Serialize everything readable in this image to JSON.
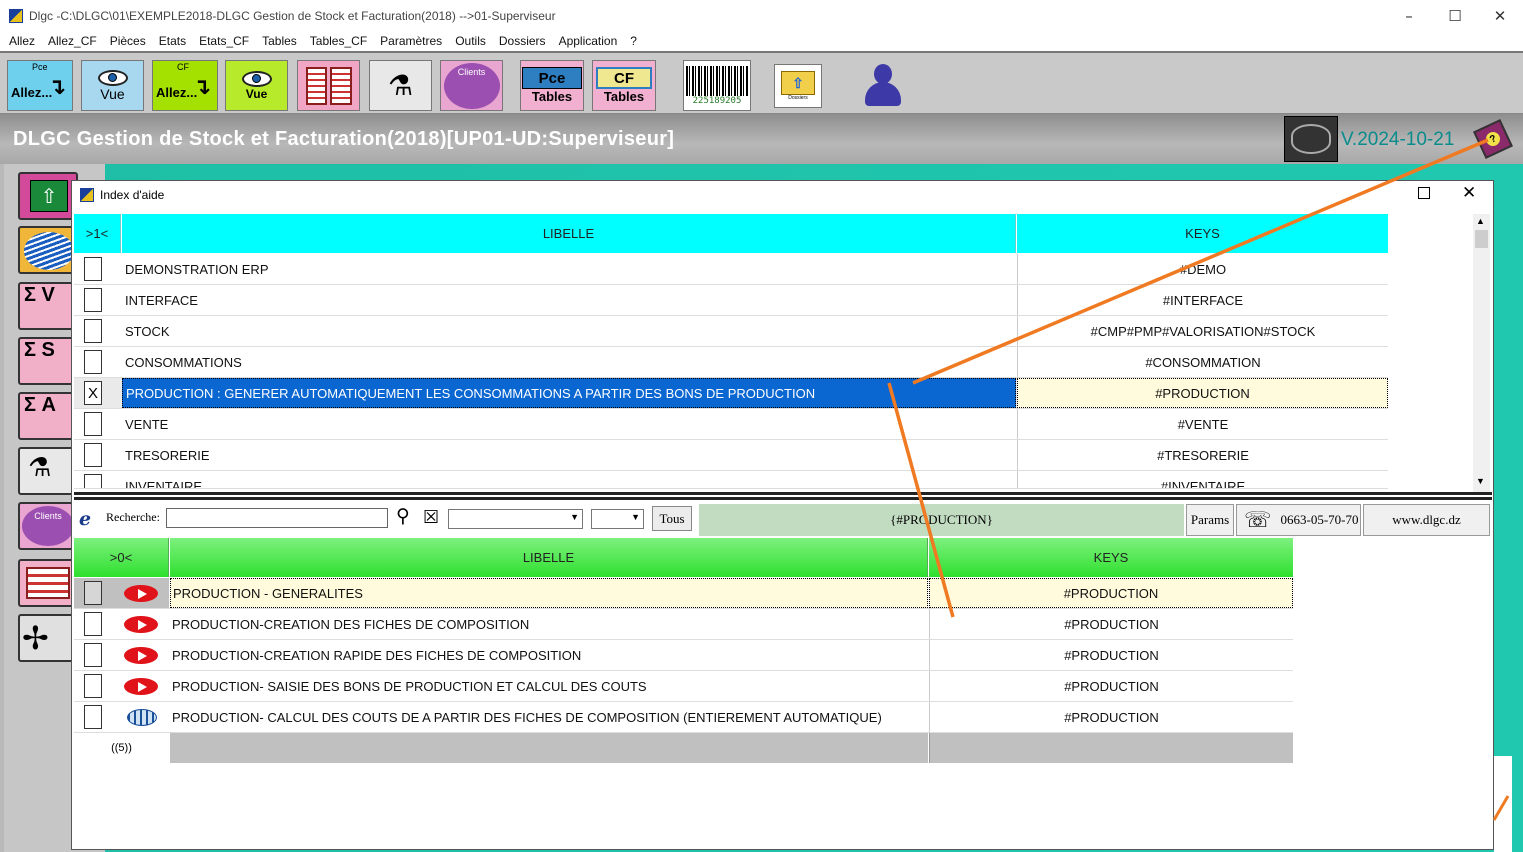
{
  "window": {
    "title": "Dlgc -C:\\DLGC\\01\\EXEMPLE2018-DLGC Gestion de Stock et Facturation(2018) -->01-Superviseur"
  },
  "menu": [
    "Allez",
    "Allez_CF",
    "Pièces",
    "Etats",
    "Etats_CF",
    "Tables",
    "Tables_CF",
    "Paramètres",
    "Outils",
    "Dossiers",
    "Application",
    "?"
  ],
  "toolbar": {
    "allez_pce_top": "Pce",
    "allez_pce_label": "Allez...",
    "vue_label": "Vue",
    "allez_cf_top": "CF",
    "allez_cf_label": "Allez...",
    "vue_cf_label": "Vue",
    "clients_label": "Clients",
    "pce_tables_top": "Pce",
    "pce_tables_label": "Tables",
    "cf_tables_top": "CF",
    "cf_tables_label": "Tables",
    "barcode_digits": "225189205",
    "dossiers_label": "Dossiers"
  },
  "banner": {
    "title": "DLGC Gestion de Stock et Facturation(2018)[UP01-UD:Superviseur]",
    "version": "V.2024-10-21"
  },
  "sidebar": {
    "clients_label": "Clients",
    "sigma_labels": [
      "Σ V",
      "Σ S",
      "Σ A"
    ]
  },
  "dialog": {
    "title": "Index d'aide",
    "top_table": {
      "counter": ">1<",
      "col_libelle": "LIBELLE",
      "col_keys": "KEYS",
      "rows": [
        {
          "checked": "",
          "libelle": "DEMONSTRATION ERP",
          "keys": "#DEMO"
        },
        {
          "checked": "",
          "libelle": "INTERFACE",
          "keys": "#INTERFACE"
        },
        {
          "checked": "",
          "libelle": "STOCK",
          "keys": "#CMP#PMP#VALORISATION#STOCK"
        },
        {
          "checked": "",
          "libelle": "CONSOMMATIONS",
          "keys": "#CONSOMMATION"
        },
        {
          "checked": "X",
          "libelle": "PRODUCTION : GENERER AUTOMATIQUEMENT LES  CONSOMMATIONS A PARTIR DES BONS DE PRODUCTION",
          "keys": "#PRODUCTION"
        },
        {
          "checked": "",
          "libelle": "VENTE",
          "keys": "#VENTE"
        },
        {
          "checked": "",
          "libelle": "TRESORERIE",
          "keys": "#TRESORERIE"
        },
        {
          "checked": "",
          "libelle": "INVENTAIRE",
          "keys": "#INVENTAIRE"
        }
      ]
    },
    "search": {
      "label": "Recherche:",
      "value": "",
      "combo1": "",
      "combo2": "",
      "tous_button": "Tous",
      "filter_display": "{#PRODUCTION}",
      "params_button": "Params",
      "phone": "0663-05-70-70",
      "website": "www.dlgc.dz"
    },
    "bottom_table": {
      "counter": ">0<",
      "col_libelle": "LIBELLE",
      "col_keys": "KEYS",
      "rows": [
        {
          "icon": "youtube-icon",
          "libelle": "PRODUCTION - GENERALITES",
          "keys": "#PRODUCTION"
        },
        {
          "icon": "youtube-icon",
          "libelle": "PRODUCTION-CREATION DES FICHES DE COMPOSITION",
          "keys": "#PRODUCTION"
        },
        {
          "icon": "youtube-icon",
          "libelle": "PRODUCTION-CREATION RAPIDE DES FICHES DE COMPOSITION",
          "keys": "#PRODUCTION"
        },
        {
          "icon": "youtube-icon",
          "libelle": "PRODUCTION- SAISIE DES BONS DE PRODUCTION ET CALCUL DES COUTS",
          "keys": "#PRODUCTION"
        },
        {
          "icon": "globe-icon",
          "libelle": "PRODUCTION- CALCUL DES COUTS DE  A PARTIR DES FICHES DE COMPOSITION  (ENTIEREMENT AUTOMATIQUE)",
          "keys": "#PRODUCTION"
        }
      ],
      "footer_count": "((5))"
    }
  },
  "colors": {
    "header_cyan": "#00ffff",
    "selection_blue": "#0a66d0",
    "selection_key_bg": "#fffbdc",
    "bottom_header_green": "#3cf03c",
    "filter_bg": "#c2dcc2",
    "annotation_orange": "#f07a22"
  }
}
